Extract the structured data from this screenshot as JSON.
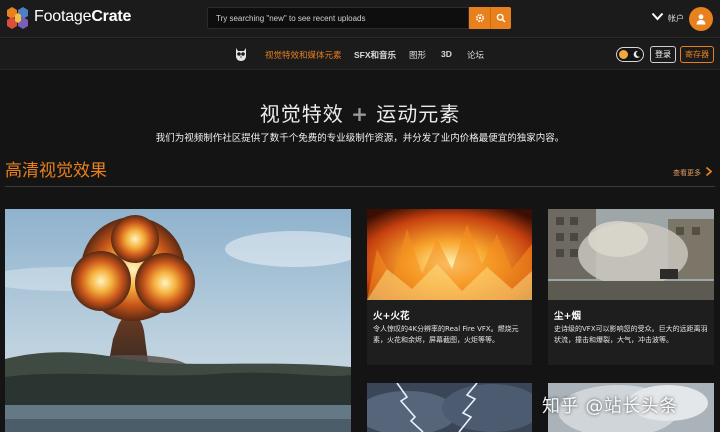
{
  "header": {
    "brand_part1": "Footage",
    "brand_part2": "Crate",
    "search_placeholder": "Try searching \"new\" to see recent uploads",
    "account_label": "帐户"
  },
  "nav": {
    "items": [
      {
        "label": "视觉特效和媒体元素",
        "active": true
      },
      {
        "label": "SFX和音乐"
      },
      {
        "label": "图形"
      },
      {
        "label": "3D"
      },
      {
        "label": "论坛"
      }
    ],
    "login_label": "登录",
    "register_label": "寄存器"
  },
  "hero": {
    "title_left": "视觉特效",
    "title_plus": "+",
    "title_right": "运动元素",
    "subtitle": "我们为视频制作社区提供了数千个免费的专业级制作资源，并分发了业内价格最便宜的独家内容。"
  },
  "section": {
    "title": "高清视觉效果",
    "see_more": "查看更多"
  },
  "cards": [
    {
      "title": "火+火花",
      "desc": "令人惊叹的4K分辨率的Real Fire VFX。燃烧元素，火花和余烬，屏幕截图，火炬等等。"
    },
    {
      "title": "尘+烟",
      "desc": "史诗级的VFX可以影响您的受众。巨大的远距离羽状流，撞击和爆裂，大气，冲击波等。"
    }
  ],
  "watermark": "知乎 @站长头条",
  "colors": {
    "accent": "#e8801e",
    "background": "#141414",
    "header_bg": "#1b1b1b"
  }
}
